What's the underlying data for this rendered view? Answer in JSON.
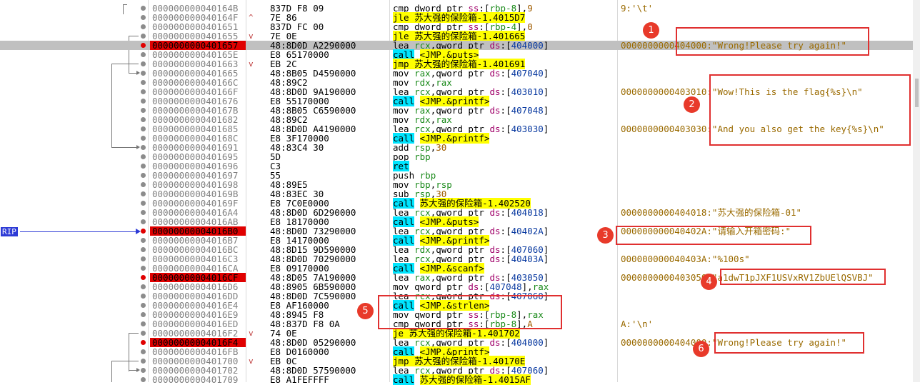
{
  "rip_label": "RIP",
  "rows": [
    {
      "addr": "000000000040164B",
      "bytes": "837D F8 09",
      "mark": "",
      "parts": [
        [
          "m",
          "cmp "
        ],
        [
          "kw",
          "dword ptr "
        ],
        [
          "seg",
          "ss"
        ],
        [
          "m",
          ":["
        ],
        [
          "reg",
          "rbp-8"
        ],
        [
          "m",
          "],"
        ],
        [
          "num",
          "9"
        ]
      ],
      "cmt": "9:'\\t'"
    },
    {
      "addr": "000000000040164F",
      "bytes": "7E 86",
      "mark": "^",
      "parts": [
        [
          "jmp",
          "jle 苏大强的保险箱-1.4015D7"
        ]
      ],
      "cmt": ""
    },
    {
      "addr": "0000000000401651",
      "bytes": "837D FC 00",
      "mark": "",
      "parts": [
        [
          "m",
          "cmp "
        ],
        [
          "kw",
          "dword ptr "
        ],
        [
          "seg",
          "ss"
        ],
        [
          "m",
          ":["
        ],
        [
          "reg",
          "rbp-4"
        ],
        [
          "m",
          "],"
        ],
        [
          "num",
          "0"
        ]
      ],
      "cmt": ""
    },
    {
      "addr": "0000000000401655",
      "bytes": "7E 0E",
      "mark": "v",
      "parts": [
        [
          "jmp",
          "jle 苏大强的保险箱-1.401665"
        ]
      ],
      "cmt": ""
    },
    {
      "addr": "0000000000401657",
      "bytes": "48:8D0D A2290000",
      "mark": "",
      "bp": true,
      "hl": true,
      "parts": [
        [
          "m",
          "lea "
        ],
        [
          "reg",
          "rcx"
        ],
        [
          "m",
          ","
        ],
        [
          "kw",
          "qword ptr "
        ],
        [
          "seg",
          "ds"
        ],
        [
          "m",
          ":["
        ],
        [
          "ptr",
          "404000"
        ],
        [
          "m",
          "]"
        ]
      ],
      "cmt": "0000000000404000:\"Wrong!Please try again!\""
    },
    {
      "addr": "000000000040165E",
      "bytes": "E8 65170000",
      "mark": "",
      "parts": [
        [
          "call",
          "call"
        ],
        [
          "m",
          " "
        ],
        [
          "sym",
          "<JMP.&puts>"
        ]
      ],
      "cmt": ""
    },
    {
      "addr": "0000000000401663",
      "bytes": "EB 2C",
      "mark": "v",
      "parts": [
        [
          "jmp",
          "jmp 苏大强的保险箱-1.401691"
        ]
      ],
      "cmt": ""
    },
    {
      "addr": "0000000000401665",
      "bytes": "48:8B05 D4590000",
      "mark": "",
      "parts": [
        [
          "m",
          "mov "
        ],
        [
          "reg",
          "rax"
        ],
        [
          "m",
          ","
        ],
        [
          "kw",
          "qword ptr "
        ],
        [
          "seg",
          "ds"
        ],
        [
          "m",
          ":["
        ],
        [
          "ptr",
          "407040"
        ],
        [
          "m",
          "]"
        ]
      ],
      "cmt": ""
    },
    {
      "addr": "000000000040166C",
      "bytes": "48:89C2",
      "mark": "",
      "parts": [
        [
          "m",
          "mov "
        ],
        [
          "reg",
          "rdx"
        ],
        [
          "m",
          ","
        ],
        [
          "reg",
          "rax"
        ]
      ],
      "cmt": ""
    },
    {
      "addr": "000000000040166F",
      "bytes": "48:8D0D 9A190000",
      "mark": "",
      "parts": [
        [
          "m",
          "lea "
        ],
        [
          "reg",
          "rcx"
        ],
        [
          "m",
          ","
        ],
        [
          "kw",
          "qword ptr "
        ],
        [
          "seg",
          "ds"
        ],
        [
          "m",
          ":["
        ],
        [
          "ptr",
          "403010"
        ],
        [
          "m",
          "]"
        ]
      ],
      "cmt": "0000000000403010:\"Wow!This is the flag{%s}\\n\""
    },
    {
      "addr": "0000000000401676",
      "bytes": "E8 55170000",
      "mark": "",
      "parts": [
        [
          "call",
          "call"
        ],
        [
          "m",
          " "
        ],
        [
          "sym",
          "<JMP.&printf>"
        ]
      ],
      "cmt": ""
    },
    {
      "addr": "000000000040167B",
      "bytes": "48:8B05 C6590000",
      "mark": "",
      "parts": [
        [
          "m",
          "mov "
        ],
        [
          "reg",
          "rax"
        ],
        [
          "m",
          ","
        ],
        [
          "kw",
          "qword ptr "
        ],
        [
          "seg",
          "ds"
        ],
        [
          "m",
          ":["
        ],
        [
          "ptr",
          "407048"
        ],
        [
          "m",
          "]"
        ]
      ],
      "cmt": ""
    },
    {
      "addr": "0000000000401682",
      "bytes": "48:89C2",
      "mark": "",
      "parts": [
        [
          "m",
          "mov "
        ],
        [
          "reg",
          "rdx"
        ],
        [
          "m",
          ","
        ],
        [
          "reg",
          "rax"
        ]
      ],
      "cmt": ""
    },
    {
      "addr": "0000000000401685",
      "bytes": "48:8D0D A4190000",
      "mark": "",
      "parts": [
        [
          "m",
          "lea "
        ],
        [
          "reg",
          "rcx"
        ],
        [
          "m",
          ","
        ],
        [
          "kw",
          "qword ptr "
        ],
        [
          "seg",
          "ds"
        ],
        [
          "m",
          ":["
        ],
        [
          "ptr",
          "403030"
        ],
        [
          "m",
          "]"
        ]
      ],
      "cmt": "0000000000403030:\"And you also get the key{%s}\\n\""
    },
    {
      "addr": "000000000040168C",
      "bytes": "E8 3F170000",
      "mark": "",
      "parts": [
        [
          "call",
          "call"
        ],
        [
          "m",
          " "
        ],
        [
          "sym",
          "<JMP.&printf>"
        ]
      ],
      "cmt": ""
    },
    {
      "addr": "0000000000401691",
      "bytes": "48:83C4 30",
      "mark": "",
      "parts": [
        [
          "m",
          "add "
        ],
        [
          "reg",
          "rsp"
        ],
        [
          "m",
          ","
        ],
        [
          "num",
          "30"
        ]
      ],
      "cmt": ""
    },
    {
      "addr": "0000000000401695",
      "bytes": "5D",
      "mark": "",
      "parts": [
        [
          "m",
          "pop "
        ],
        [
          "reg",
          "rbp"
        ]
      ],
      "cmt": ""
    },
    {
      "addr": "0000000000401696",
      "bytes": "C3",
      "mark": "",
      "parts": [
        [
          "call",
          "ret"
        ]
      ],
      "cmt": ""
    },
    {
      "addr": "0000000000401697",
      "bytes": "55",
      "mark": "",
      "parts": [
        [
          "m",
          "push "
        ],
        [
          "reg",
          "rbp"
        ]
      ],
      "cmt": ""
    },
    {
      "addr": "0000000000401698",
      "bytes": "48:89E5",
      "mark": "",
      "parts": [
        [
          "m",
          "mov "
        ],
        [
          "reg",
          "rbp"
        ],
        [
          "m",
          ","
        ],
        [
          "reg",
          "rsp"
        ]
      ],
      "cmt": ""
    },
    {
      "addr": "000000000040169B",
      "bytes": "48:83EC 30",
      "mark": "",
      "parts": [
        [
          "m",
          "sub "
        ],
        [
          "reg",
          "rsp"
        ],
        [
          "m",
          ","
        ],
        [
          "num",
          "30"
        ]
      ],
      "cmt": ""
    },
    {
      "addr": "000000000040169F",
      "bytes": "E8 7C0E0000",
      "mark": "",
      "parts": [
        [
          "call",
          "call"
        ],
        [
          "m",
          " "
        ],
        [
          "sym",
          "苏大强的保险箱-1.402520"
        ]
      ],
      "cmt": ""
    },
    {
      "addr": "00000000004016A4",
      "bytes": "48:8D0D 6D290000",
      "mark": "",
      "parts": [
        [
          "m",
          "lea "
        ],
        [
          "reg",
          "rcx"
        ],
        [
          "m",
          ","
        ],
        [
          "kw",
          "qword ptr "
        ],
        [
          "seg",
          "ds"
        ],
        [
          "m",
          ":["
        ],
        [
          "ptr",
          "404018"
        ],
        [
          "m",
          "]"
        ]
      ],
      "cmt": "0000000000404018:\"苏大强的保险箱-01\""
    },
    {
      "addr": "00000000004016AB",
      "bytes": "E8 18170000",
      "mark": "",
      "parts": [
        [
          "call",
          "call"
        ],
        [
          "m",
          " "
        ],
        [
          "sym",
          "<JMP.&puts>"
        ]
      ],
      "cmt": ""
    },
    {
      "addr": "00000000004016B0",
      "bytes": "48:8D0D 73290000",
      "mark": "",
      "rip": true,
      "parts": [
        [
          "m",
          "lea "
        ],
        [
          "reg",
          "rcx"
        ],
        [
          "m",
          ","
        ],
        [
          "kw",
          "qword ptr "
        ],
        [
          "seg",
          "ds"
        ],
        [
          "m",
          ":["
        ],
        [
          "ptr",
          "40402A"
        ],
        [
          "m",
          "]"
        ]
      ],
      "cmt": "000000000040402A:\"请输入开箱密码:\""
    },
    {
      "addr": "00000000004016B7",
      "bytes": "E8 14170000",
      "mark": "",
      "parts": [
        [
          "call",
          "call"
        ],
        [
          "m",
          " "
        ],
        [
          "sym",
          "<JMP.&printf>"
        ]
      ],
      "cmt": ""
    },
    {
      "addr": "00000000004016BC",
      "bytes": "48:8D15 9D590000",
      "mark": "",
      "parts": [
        [
          "m",
          "lea "
        ],
        [
          "reg",
          "rdx"
        ],
        [
          "m",
          ","
        ],
        [
          "kw",
          "qword ptr "
        ],
        [
          "seg",
          "ds"
        ],
        [
          "m",
          ":["
        ],
        [
          "ptr",
          "407060"
        ],
        [
          "m",
          "]"
        ]
      ],
      "cmt": ""
    },
    {
      "addr": "00000000004016C3",
      "bytes": "48:8D0D 70290000",
      "mark": "",
      "parts": [
        [
          "m",
          "lea "
        ],
        [
          "reg",
          "rcx"
        ],
        [
          "m",
          ","
        ],
        [
          "kw",
          "qword ptr "
        ],
        [
          "seg",
          "ds"
        ],
        [
          "m",
          ":["
        ],
        [
          "ptr",
          "40403A"
        ],
        [
          "m",
          "]"
        ]
      ],
      "cmt": "000000000040403A:\"%100s\""
    },
    {
      "addr": "00000000004016CA",
      "bytes": "E8 09170000",
      "mark": "",
      "parts": [
        [
          "call",
          "call"
        ],
        [
          "m",
          " "
        ],
        [
          "sym",
          "<JMP.&scanf>"
        ]
      ],
      "cmt": ""
    },
    {
      "addr": "00000000004016CF",
      "bytes": "48:8D05 7A190000",
      "mark": "",
      "bp": true,
      "parts": [
        [
          "m",
          "lea "
        ],
        [
          "reg",
          "rax"
        ],
        [
          "m",
          ","
        ],
        [
          "kw",
          "qword ptr "
        ],
        [
          "seg",
          "ds"
        ],
        [
          "m",
          ":["
        ],
        [
          "ptr",
          "403050"
        ],
        [
          "m",
          "]"
        ]
      ],
      "cmt": "0000000000403050:\"a1dwT1pJXF1USVxRV1ZbUElQSVBJ\""
    },
    {
      "addr": "00000000004016D6",
      "bytes": "48:8905 6B590000",
      "mark": "",
      "parts": [
        [
          "m",
          "mov "
        ],
        [
          "kw",
          "qword ptr "
        ],
        [
          "seg",
          "ds"
        ],
        [
          "m",
          ":["
        ],
        [
          "ptr",
          "407048"
        ],
        [
          "m",
          "],"
        ],
        [
          "reg",
          "rax"
        ]
      ],
      "cmt": ""
    },
    {
      "addr": "00000000004016DD",
      "bytes": "48:8D0D 7C590000",
      "mark": "",
      "parts": [
        [
          "m",
          "lea "
        ],
        [
          "reg",
          "rcx"
        ],
        [
          "m",
          ","
        ],
        [
          "kw",
          "qword ptr "
        ],
        [
          "seg",
          "ds"
        ],
        [
          "m",
          ":["
        ],
        [
          "ptr",
          "407060"
        ],
        [
          "m",
          "]"
        ]
      ],
      "cmt": ""
    },
    {
      "addr": "00000000004016E4",
      "bytes": "E8 AF160000",
      "mark": "",
      "parts": [
        [
          "call",
          "call"
        ],
        [
          "m",
          " "
        ],
        [
          "sym",
          "<JMP.&strlen>"
        ]
      ],
      "cmt": ""
    },
    {
      "addr": "00000000004016E9",
      "bytes": "48:8945 F8",
      "mark": "",
      "parts": [
        [
          "m",
          "mov "
        ],
        [
          "kw",
          "qword ptr "
        ],
        [
          "seg",
          "ss"
        ],
        [
          "m",
          ":["
        ],
        [
          "reg",
          "rbp-8"
        ],
        [
          "m",
          "],"
        ],
        [
          "reg",
          "rax"
        ]
      ],
      "cmt": ""
    },
    {
      "addr": "00000000004016ED",
      "bytes": "48:837D F8 0A",
      "mark": "",
      "parts": [
        [
          "m",
          "cmp "
        ],
        [
          "kw",
          "qword ptr "
        ],
        [
          "seg",
          "ss"
        ],
        [
          "m",
          ":["
        ],
        [
          "reg",
          "rbp-8"
        ],
        [
          "m",
          "],"
        ],
        [
          "num",
          "A"
        ]
      ],
      "cmt": "A:'\\n'"
    },
    {
      "addr": "00000000004016F2",
      "bytes": "74 0E",
      "mark": "v",
      "parts": [
        [
          "jmp",
          "je 苏大强的保险箱-1.401702"
        ]
      ],
      "cmt": ""
    },
    {
      "addr": "00000000004016F4",
      "bytes": "48:8D0D 05290000",
      "mark": "",
      "bp": true,
      "parts": [
        [
          "m",
          "lea "
        ],
        [
          "reg",
          "rcx"
        ],
        [
          "m",
          ","
        ],
        [
          "kw",
          "qword ptr "
        ],
        [
          "seg",
          "ds"
        ],
        [
          "m",
          ":["
        ],
        [
          "ptr",
          "404000"
        ],
        [
          "m",
          "]"
        ]
      ],
      "cmt": "0000000000404000:\"Wrong!Please try again!\""
    },
    {
      "addr": "00000000004016FB",
      "bytes": "E8 D0160000",
      "mark": "",
      "parts": [
        [
          "call",
          "call"
        ],
        [
          "m",
          " "
        ],
        [
          "sym",
          "<JMP.&printf>"
        ]
      ],
      "cmt": ""
    },
    {
      "addr": "0000000000401700",
      "bytes": "EB 0C",
      "mark": "v",
      "parts": [
        [
          "jmp",
          "jmp 苏大强的保险箱-1.40170E"
        ]
      ],
      "cmt": ""
    },
    {
      "addr": "0000000000401702",
      "bytes": "48:8D0D 57590000",
      "mark": "",
      "parts": [
        [
          "m",
          "lea "
        ],
        [
          "reg",
          "rcx"
        ],
        [
          "m",
          ","
        ],
        [
          "kw",
          "qword ptr "
        ],
        [
          "seg",
          "ds"
        ],
        [
          "m",
          ":["
        ],
        [
          "ptr",
          "407060"
        ],
        [
          "m",
          "]"
        ]
      ],
      "cmt": ""
    },
    {
      "addr": "0000000000401709",
      "bytes": "E8 A1FEFFFF",
      "mark": "",
      "parts": [
        [
          "call",
          "call"
        ],
        [
          "m",
          " "
        ],
        [
          "sym",
          "苏大强的保险箱-1.4015AF"
        ]
      ],
      "cmt": ""
    }
  ],
  "annotations": [
    {
      "n": "1"
    },
    {
      "n": "2"
    },
    {
      "n": "3"
    },
    {
      "n": "4"
    },
    {
      "n": "5"
    },
    {
      "n": "6"
    }
  ]
}
